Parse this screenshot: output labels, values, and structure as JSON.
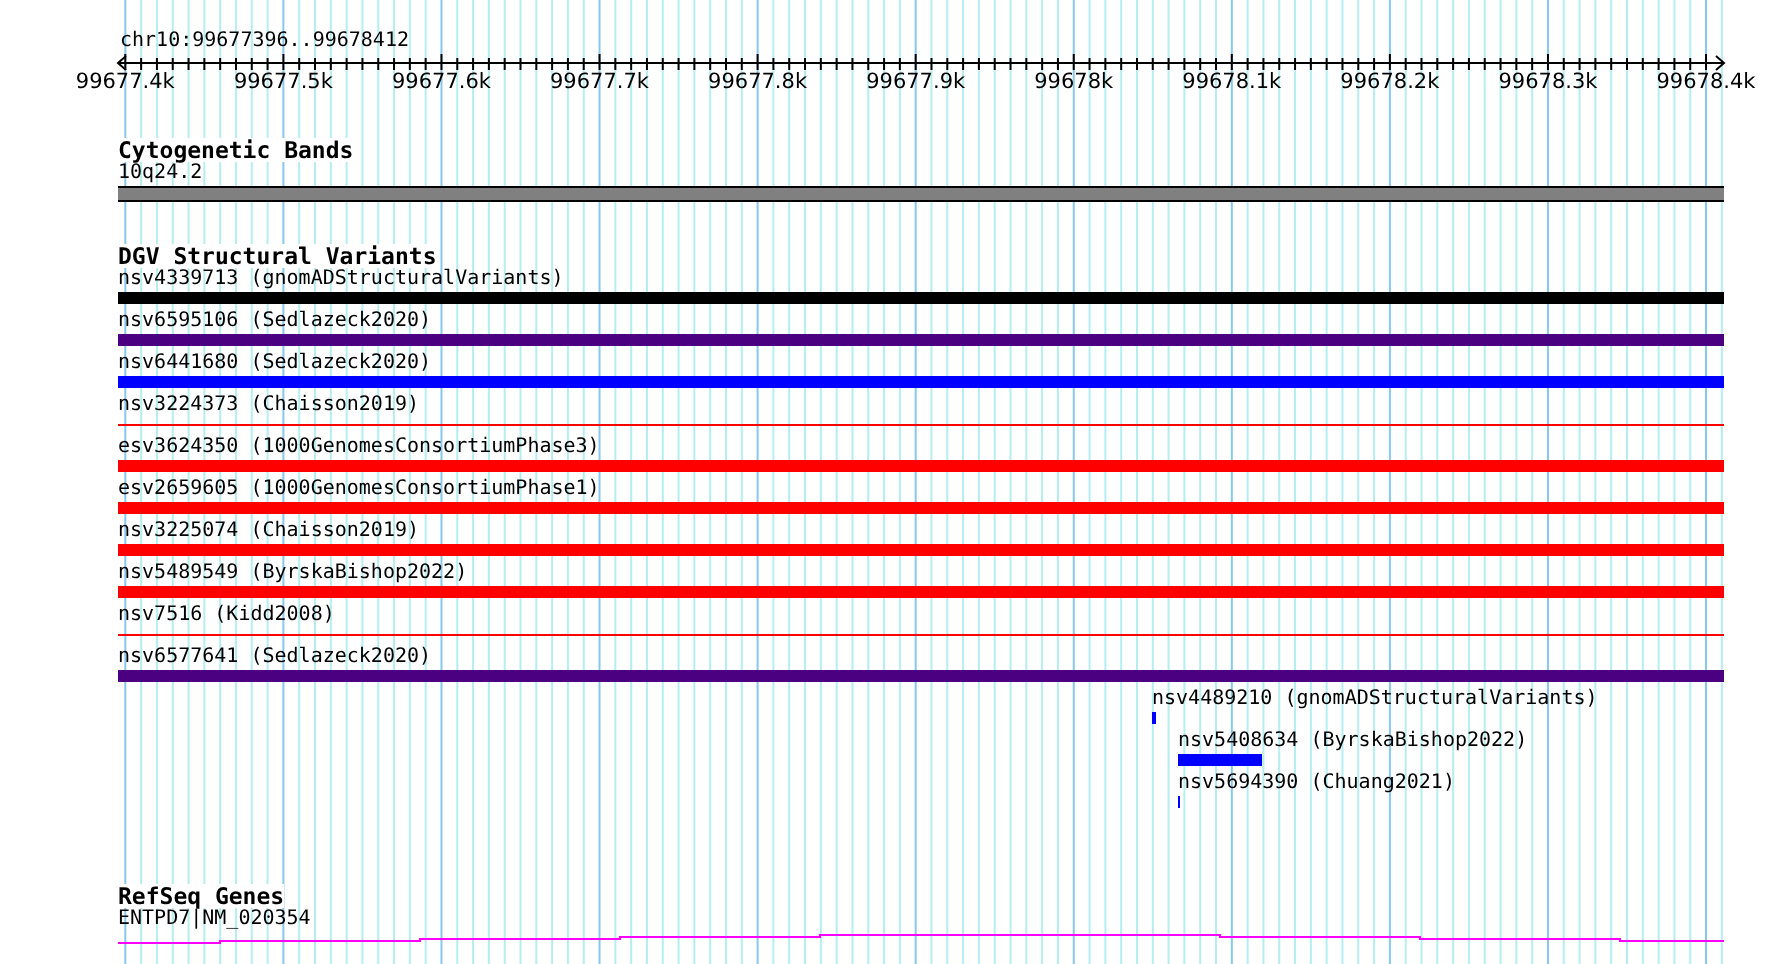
{
  "location": "chr10:99677396..99678412",
  "ruler": {
    "ticks": [
      "99677.4k",
      "99677.5k",
      "99677.6k",
      "99677.7k",
      "99677.8k",
      "99677.9k",
      "99678k",
      "99678.1k",
      "99678.2k",
      "99678.3k",
      "99678.4k"
    ]
  },
  "cytogenetic_bands": {
    "title": "Cytogenetic Bands",
    "band": "10q24.2"
  },
  "structural_variants": {
    "title": "DGV Structural Variants",
    "items": [
      {
        "label": "nsv4339713 (gnomADStructuralVariants)",
        "color": "#000000",
        "kind": "thick"
      },
      {
        "label": "nsv6595106 (Sedlazeck2020)",
        "color": "#4b0082",
        "kind": "thick"
      },
      {
        "label": "nsv6441680 (Sedlazeck2020)",
        "color": "#0000ff",
        "kind": "thick"
      },
      {
        "label": "nsv3224373 (Chaisson2019)",
        "color": "#ff0000",
        "kind": "thin"
      },
      {
        "label": "esv3624350 (1000GenomesConsortiumPhase3)",
        "color": "#ff0000",
        "kind": "thick"
      },
      {
        "label": "esv2659605 (1000GenomesConsortiumPhase1)",
        "color": "#ff0000",
        "kind": "thick"
      },
      {
        "label": "nsv3225074 (Chaisson2019)",
        "color": "#ff0000",
        "kind": "thick"
      },
      {
        "label": "nsv5489549 (ByrskaBishop2022)",
        "color": "#ff0000",
        "kind": "thick"
      },
      {
        "label": "nsv7516 (Kidd2008)",
        "color": "#ff0000",
        "kind": "thin"
      },
      {
        "label": "nsv6577641 (Sedlazeck2020)",
        "color": "#4b0082",
        "kind": "thick"
      },
      {
        "label": "nsv4489210 (gnomADStructuralVariants)",
        "color": "#0000ff",
        "kind": "thick"
      },
      {
        "label": "nsv5408634 (ByrskaBishop2022)",
        "color": "#0000ff",
        "kind": "thick"
      },
      {
        "label": "nsv5694390 (Chuang2021)",
        "color": "#0000ff",
        "kind": "thick"
      }
    ]
  },
  "refseq_genes": {
    "title": "RefSeq Genes",
    "gene": "ENTPD7|NM_020354"
  }
}
